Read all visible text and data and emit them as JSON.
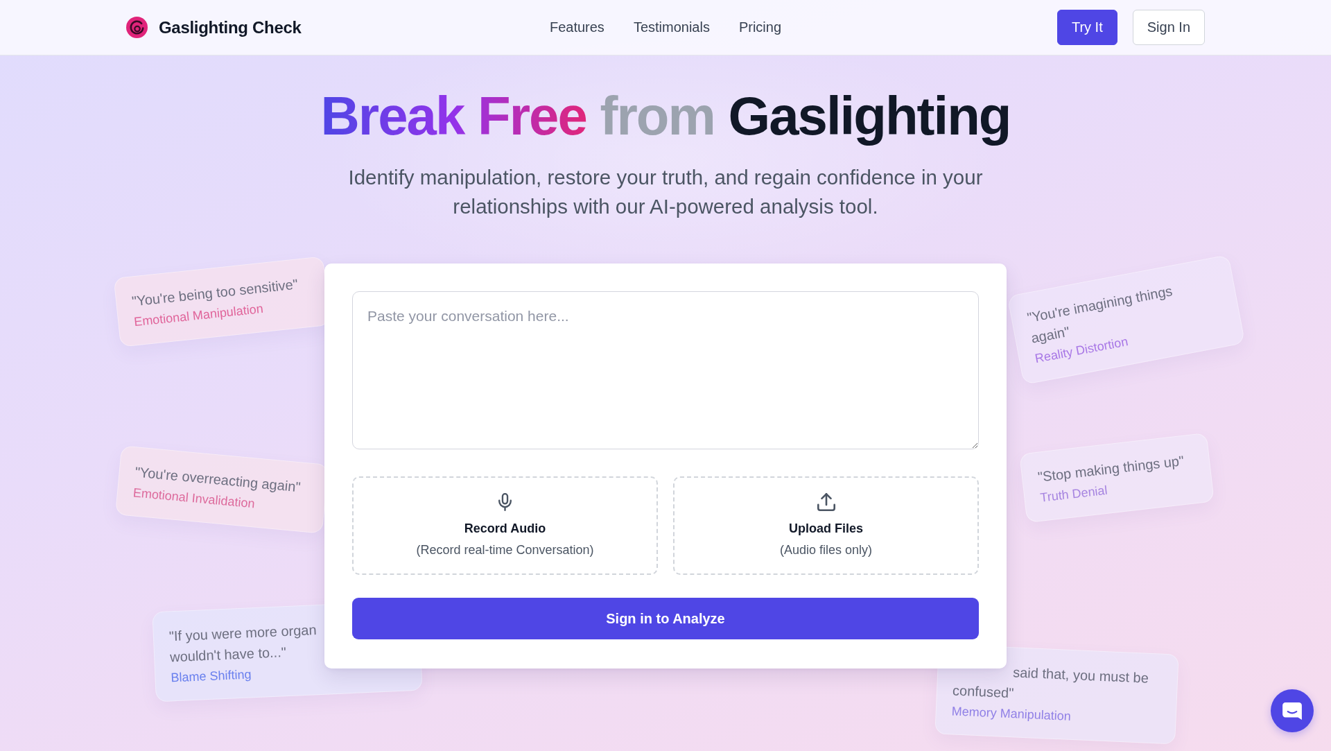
{
  "header": {
    "brand": "Gaslighting Check",
    "nav": [
      {
        "label": "Features"
      },
      {
        "label": "Testimonials"
      },
      {
        "label": "Pricing"
      }
    ],
    "actions": [
      {
        "label": "Try It",
        "kind": "primary"
      },
      {
        "label": "Sign In",
        "kind": "secondary"
      }
    ]
  },
  "hero": {
    "title": [
      {
        "text": "Break Free",
        "kind": "gradient"
      },
      {
        "text": "from",
        "kind": "muted"
      },
      {
        "text": "Gaslighting",
        "kind": "plain"
      }
    ],
    "subtitle": "Identify manipulation, restore your truth, and regain confidence in your relationships with our AI-powered analysis tool."
  },
  "quote_cards": [
    {
      "quote": "\"You're being too sensitive\"",
      "category": "Emotional Manipulation",
      "color": "#e0649a"
    },
    {
      "quote": "\"You're imagining things again\"",
      "category": "Reality Distortion",
      "color": "#a877e6"
    },
    {
      "quote": "\"Stop making things up\"",
      "category": "Truth Denial",
      "color": "#a684e0"
    },
    {
      "quote": "\"You're overreacting again\"",
      "category": "Emotional Invalidation",
      "color": "#dd6a9c"
    },
    {
      "quote": "\"If you were more organ\nwouldn't have to...\"",
      "category": "Blame Shifting",
      "color": "#6a80ee"
    },
    {
      "quote": "said that, you must be\nconfused\"",
      "category": "Memory Manipulation",
      "color": "#9080e6"
    }
  ],
  "analyzer": {
    "conversation_field": {
      "placeholder": "Paste your conversation here..."
    },
    "options": [
      {
        "kind": "record",
        "title": "Record Audio",
        "subtitle": "(Record real-time Conversation)"
      },
      {
        "kind": "upload",
        "title": "Upload Files",
        "subtitle": "(Audio files only)"
      }
    ],
    "submit": "Sign in to Analyze"
  }
}
